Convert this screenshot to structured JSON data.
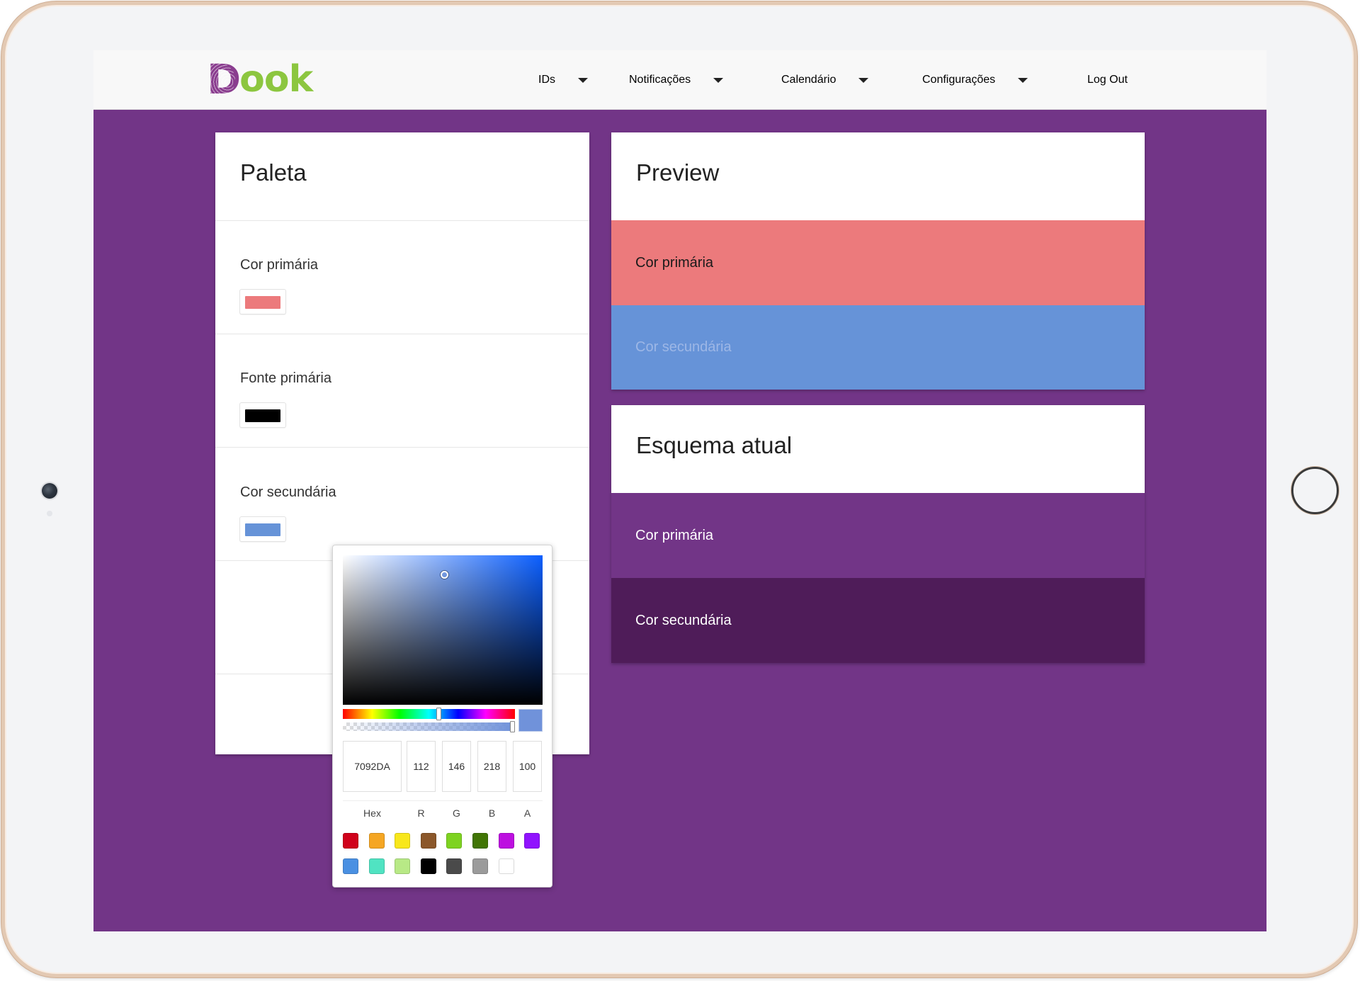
{
  "brand": {
    "logo_d": "D",
    "logo_rest": "ook"
  },
  "nav": {
    "items": [
      {
        "label": "IDs",
        "dropdown": true
      },
      {
        "label": "Notificações",
        "dropdown": true
      },
      {
        "label": "Calendário",
        "dropdown": true
      },
      {
        "label": "Configurações",
        "dropdown": true
      },
      {
        "label": "Log Out",
        "dropdown": false
      }
    ]
  },
  "palette": {
    "title": "Paleta",
    "fields": [
      {
        "label": "Cor primária",
        "color": "#ec7a7c"
      },
      {
        "label": "Fonte primária",
        "color": "#000000"
      },
      {
        "label": "Cor secundária",
        "color": "#6693d8"
      }
    ]
  },
  "preview": {
    "title": "Preview",
    "primary_label": "Cor primária",
    "secondary_label": "Cor secundária",
    "primary_color": "#ec7a7c",
    "secondary_color": "#6693d8",
    "primary_text_color": "#1a1a1a",
    "secondary_text_color": "#9db7e6"
  },
  "current_scheme": {
    "title": "Esquema atual",
    "primary_label": "Cor primária",
    "secondary_label": "Cor secundária",
    "primary_color": "#723587",
    "secondary_color": "#4f1c59",
    "text_color": "#ffffff"
  },
  "color_picker": {
    "hex": "7092DA",
    "r": "112",
    "g": "146",
    "b": "218",
    "a": "100",
    "labels": {
      "hex": "Hex",
      "r": "R",
      "g": "G",
      "b": "B",
      "a": "A"
    },
    "presets": [
      "#d0021b",
      "#f5a623",
      "#f8e71c",
      "#8b572a",
      "#7ed321",
      "#417505",
      "#bd10e0",
      "#9013fe",
      "#4a90e2",
      "#50e3c2",
      "#b8e986",
      "#000000",
      "#4a4a4a",
      "#9b9b9b",
      "#ffffff"
    ]
  },
  "colors": {
    "background": "#723587",
    "navbar": "#f8f8f8"
  }
}
